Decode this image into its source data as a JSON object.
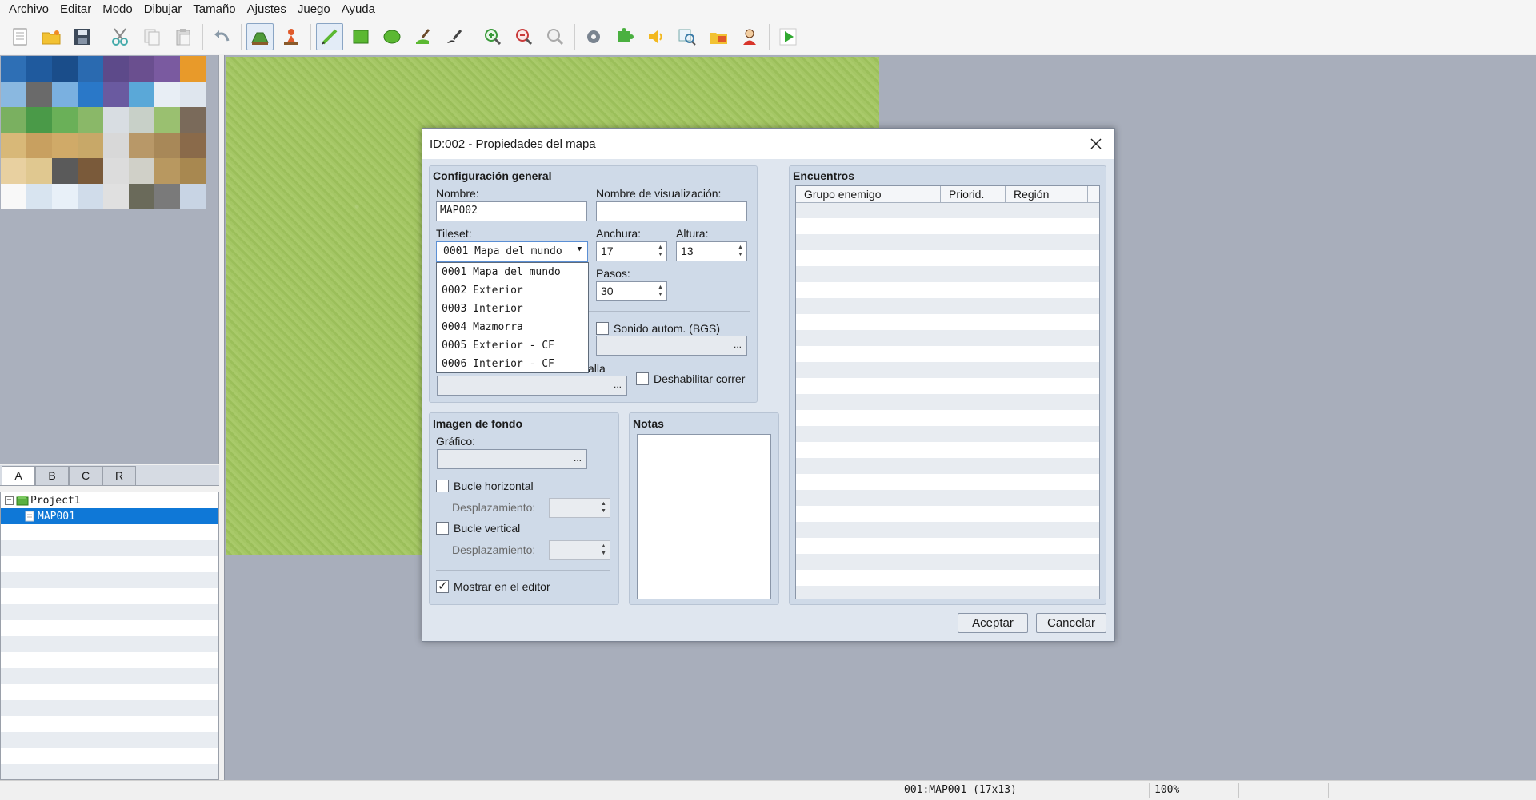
{
  "menu": [
    "Archivo",
    "Editar",
    "Modo",
    "Dibujar",
    "Tamaño",
    "Ajustes",
    "Juego",
    "Ayuda"
  ],
  "map_tabs": [
    "A",
    "B",
    "C",
    "R"
  ],
  "map_tree": {
    "project": "Project1",
    "maps": [
      "MAP001"
    ]
  },
  "statusbar": {
    "map_info": "001:MAP001 (17x13)",
    "zoom": "100%"
  },
  "dialog": {
    "title": "ID:002 - Propiedades del mapa",
    "general": {
      "heading": "Configuración general",
      "name_label": "Nombre:",
      "name_value": "MAP002",
      "display_name_label": "Nombre de visualización:",
      "display_name_value": "",
      "tileset_label": "Tileset:",
      "tileset_value": "0001 Mapa del mundo",
      "tileset_options": [
        "0001 Mapa del mundo",
        "0002 Exterior",
        "0003 Interior",
        "0004 Mazmorra",
        "0005 Exterior - CF",
        "0006 Interior - CF"
      ],
      "width_label": "Anchura:",
      "width_value": "17",
      "height_label": "Altura:",
      "height_value": "13",
      "steps_label": "Pasos:",
      "steps_value": "30",
      "bgs_label": "Sonido autom. (BGS)",
      "bgs_checked": false,
      "battleback_partial": "alla",
      "disable_dash_label": "Deshabilitar correr",
      "disable_dash_checked": false,
      "ellipsis": "..."
    },
    "background": {
      "heading": "Imagen de fondo",
      "graphic_label": "Gráfico:",
      "loop_h_label": "Bucle horizontal",
      "loop_h_checked": false,
      "scroll_label": "Desplazamiento:",
      "loop_v_label": "Bucle vertical",
      "loop_v_checked": false,
      "show_in_editor_label": "Mostrar en el editor",
      "show_in_editor_checked": true
    },
    "notes": {
      "heading": "Notas",
      "value": ""
    },
    "encounters": {
      "heading": "Encuentros",
      "columns": [
        "Grupo enemigo",
        "Priorid.",
        "Región"
      ],
      "rows": []
    },
    "ok_label": "Aceptar",
    "cancel_label": "Cancelar"
  }
}
